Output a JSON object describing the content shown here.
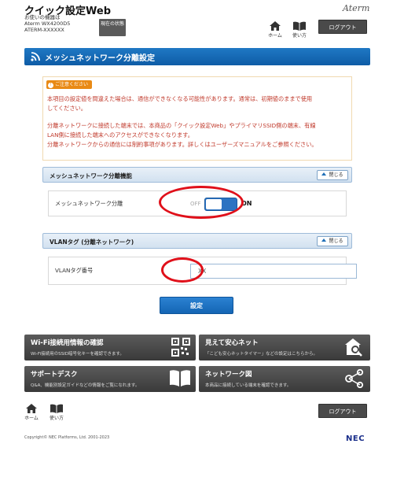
{
  "header": {
    "app_title": "クイック設定Web",
    "device_caption": "お使いの機器は",
    "device_model": "Aterm  WX4200D5",
    "device_id": "ATERM-XXXXXX",
    "status_button": "現在の状態",
    "brand": "Aterm",
    "home_label": "ホーム",
    "help_label": "使い方",
    "logout_label": "ログアウト"
  },
  "page": {
    "title": "メッシュネットワーク分離設定"
  },
  "notice": {
    "badge": "ご注意ください",
    "line1": "本項目の設定値を間違えた場合は、通信ができなくなる可能性があります。通常は、初期値のままで使用",
    "line2": "してください。",
    "line3": "分離ネットワークに接続した端末では、本商品の「クイック設定Web」やプライマリSSID側の端末、有線",
    "line4": "LAN側に接続した端末へのアクセスができなくなります。",
    "line5": "分離ネットワークからの通信には制約事項があります。詳しくはユーザーズマニュアルをご参照ください。"
  },
  "section_mesh": {
    "heading": "メッシュネットワーク分離機能",
    "collapse_label": "閉じる",
    "row_label": "メッシュネットワーク分離",
    "toggle_off": "OFF",
    "toggle_on": "ON",
    "toggle_state": "on"
  },
  "section_vlan": {
    "heading": "VLANタグ (分離ネットワーク)",
    "collapse_label": "閉じる",
    "row_label": "VLANタグ番号",
    "input_value": "XX"
  },
  "actions": {
    "submit_label": "設定"
  },
  "tiles": [
    {
      "title": "Wi-Fi接続用情報の確認",
      "subtitle": "Wi-Fi接続用のSSID暗号化キーを確認できます。",
      "icon": "qr-code-icon"
    },
    {
      "title": "見えて安心ネット",
      "subtitle": "「こども安心ネットタイマー」などの設定はこちらから。",
      "icon": "home-search-icon"
    },
    {
      "title": "サポートデスク",
      "subtitle": "Q&A、機能別設定ガイドなどの情報をご覧になれます。",
      "icon": "book-icon"
    },
    {
      "title": "ネットワーク図",
      "subtitle": "本商品に接続している端末を確認できます。",
      "icon": "network-icon"
    }
  ],
  "footer": {
    "home_label": "ホーム",
    "help_label": "使い方",
    "logout_label": "ログアウト",
    "copyright": "Copyright© NEC Platforms, Ltd. 2001-2023",
    "nec_logo": "NEC"
  },
  "colors": {
    "accent_blue": "#1f78c4",
    "notice_red": "#c0392b",
    "highlight_red": "#e0101a",
    "tile_dark": "#4a4a4a"
  }
}
